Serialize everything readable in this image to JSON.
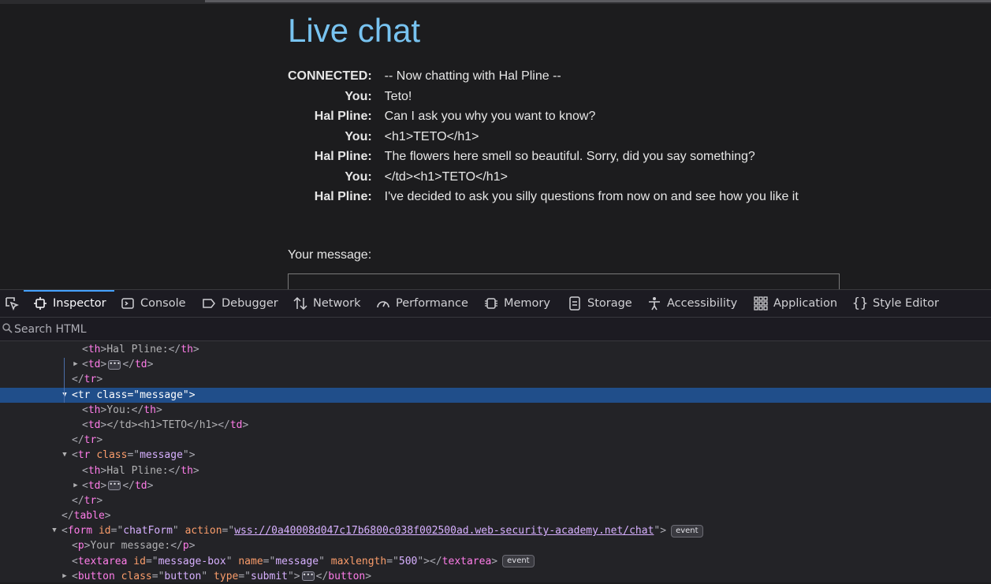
{
  "page": {
    "title": "Live chat",
    "chat": [
      {
        "sender": "CONNECTED:",
        "message": "-- Now chatting with Hal Pline --"
      },
      {
        "sender": "You:",
        "message": "Teto!"
      },
      {
        "sender": "Hal Pline:",
        "message": "Can I ask you why you want to know?"
      },
      {
        "sender": "You:",
        "message": "<h1>TETO</h1>"
      },
      {
        "sender": "Hal Pline:",
        "message": "The flowers here smell so beautiful. Sorry, did you say something?"
      },
      {
        "sender": "You:",
        "message": "</td><h1>TETO</h1>"
      },
      {
        "sender": "Hal Pline:",
        "message": "I've decided to ask you silly questions from now on and see how you like it"
      }
    ],
    "your_message_label": "Your message:"
  },
  "devtools": {
    "tabs": [
      {
        "label": "Inspector",
        "icon": "inspector-icon",
        "active": true
      },
      {
        "label": "Console",
        "icon": "console-icon"
      },
      {
        "label": "Debugger",
        "icon": "debugger-icon"
      },
      {
        "label": "Network",
        "icon": "network-icon"
      },
      {
        "label": "Performance",
        "icon": "performance-icon"
      },
      {
        "label": "Memory",
        "icon": "memory-icon"
      },
      {
        "label": "Storage",
        "icon": "storage-icon"
      },
      {
        "label": "Accessibility",
        "icon": "accessibility-icon"
      },
      {
        "label": "Application",
        "icon": "application-icon"
      },
      {
        "label": "Style Editor",
        "icon": "style-editor-icon"
      }
    ],
    "search_placeholder": "Search HTML",
    "tree": {
      "l1_th": "Hal Pline:",
      "l5_th": "You:",
      "l6_td": "</td><h1>TETO</h1>",
      "l9_th": "Hal Pline:",
      "form_id": "chatForm",
      "form_action": "wss://0a40008d047c17b6800c038f002500ad.web-security-academy.net/chat",
      "event_badge": "event",
      "p_text": "Your message:",
      "textarea_id": "message-box",
      "textarea_name": "message",
      "textarea_maxlength": "500",
      "button_class": "button",
      "button_type": "submit",
      "tr_class": "message"
    }
  },
  "colors": {
    "page_bg": "#1c1c1e",
    "title": "#78c3f0",
    "selection": "#204e8a",
    "tag": "#ff7de9",
    "attr_name": "#fb9d6b",
    "attr_value": "#d7b0ff",
    "active_tab": "#45a1ff"
  }
}
